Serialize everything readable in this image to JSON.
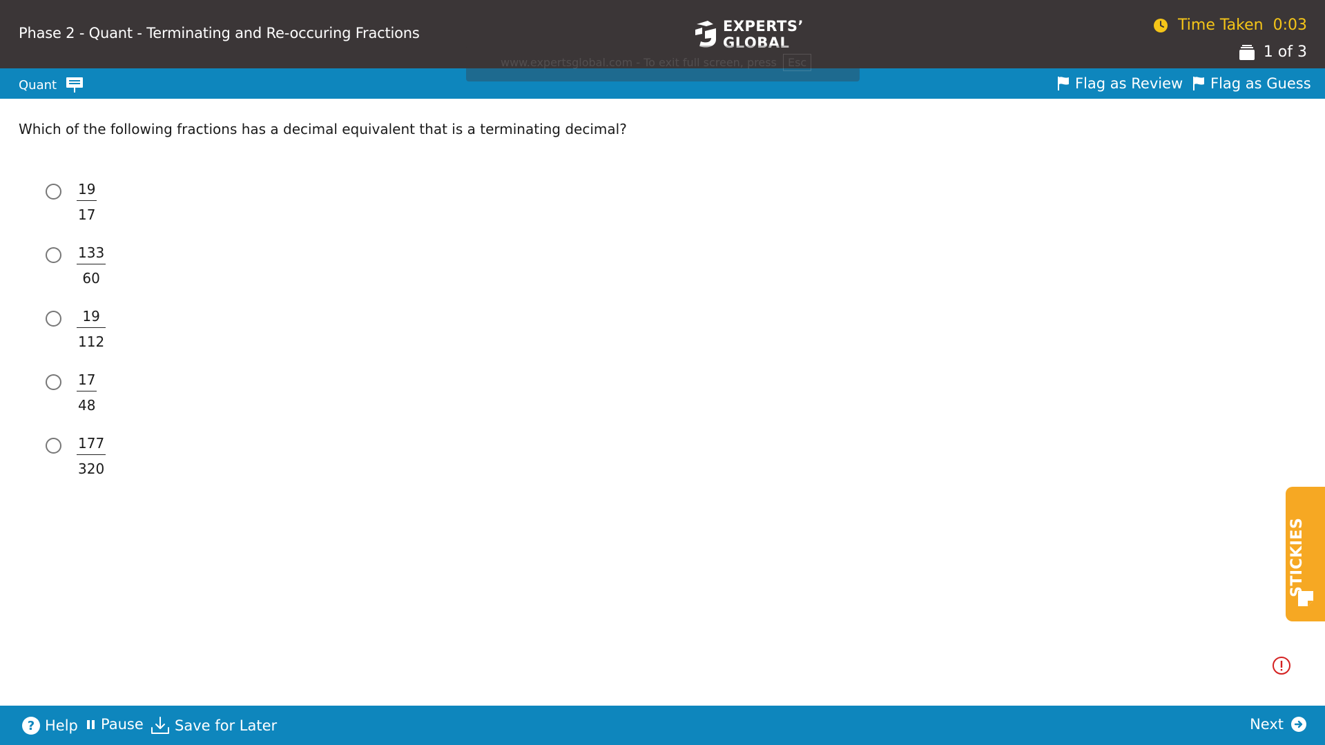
{
  "header": {
    "title": "Phase 2 - Quant - Terminating and Re-occuring Fractions",
    "logo_line1": "EXPERTS’",
    "logo_line2": "GLOBAL",
    "overlay_hint": "www.expertsglobal.com - To exit full screen, press",
    "overlay_key": "Esc",
    "time_label": "Time Taken",
    "time_value": "0:03",
    "question_position": "1 of 3",
    "colors": {
      "header_bg": "#3b3637",
      "timer": "#f5c518"
    }
  },
  "subheader": {
    "section": "Quant",
    "flag_review": "Flag as Review",
    "flag_guess": "Flag as Guess",
    "color": "#0e86bd"
  },
  "question": {
    "text": "Which of the following fractions has a decimal equivalent that is a terminating decimal?",
    "choices": [
      {
        "numerator": "19",
        "denominator": "17"
      },
      {
        "numerator": "133",
        "denominator": "60"
      },
      {
        "numerator": "19",
        "denominator": "112"
      },
      {
        "numerator": "17",
        "denominator": "48"
      },
      {
        "numerator": "177",
        "denominator": "320"
      }
    ]
  },
  "stickies": {
    "label": "STICKIES",
    "color": "#f6a823"
  },
  "footer": {
    "help": "Help",
    "pause": "Pause",
    "save": "Save for Later",
    "next": "Next"
  }
}
